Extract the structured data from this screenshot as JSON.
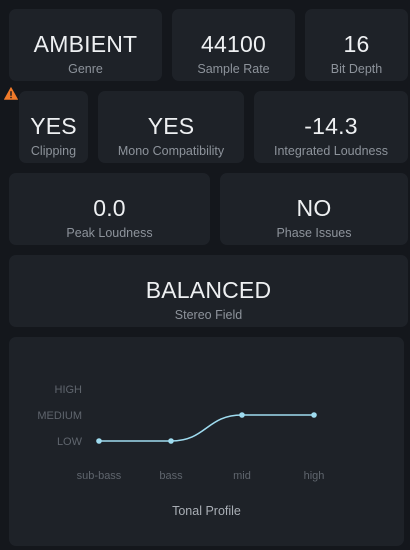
{
  "metrics": {
    "genre": {
      "value": "AMBIENT",
      "label": "Genre"
    },
    "sample_rate": {
      "value": "44100",
      "label": "Sample Rate"
    },
    "bit_depth": {
      "value": "16",
      "label": "Bit Depth"
    },
    "clipping": {
      "value": "YES",
      "label": "Clipping",
      "warning_icon": "warning-triangle-icon"
    },
    "mono_compatibility": {
      "value": "YES",
      "label": "Mono Compatibility"
    },
    "integrated_loudness": {
      "value": "-14.3",
      "label": "Integrated Loudness"
    },
    "peak_loudness": {
      "value": "0.0",
      "label": "Peak Loudness"
    },
    "phase_issues": {
      "value": "NO",
      "label": "Phase Issues"
    },
    "stereo_field": {
      "value": "BALANCED",
      "label": "Stereo Field"
    }
  },
  "colors": {
    "background": "#14171c",
    "card": "#1e2228",
    "warning": "#f07a2a",
    "curve": "#9fdcf0"
  },
  "chart_data": {
    "type": "line",
    "title": "Tonal Profile",
    "categories": [
      "sub-bass",
      "bass",
      "mid",
      "high"
    ],
    "y_levels": [
      "LOW",
      "MEDIUM",
      "HIGH"
    ],
    "series": [
      {
        "values": [
          1.0,
          1.0,
          2.0,
          2.0
        ]
      }
    ],
    "ylim": [
      1,
      3
    ],
    "smooth": true,
    "grid": false,
    "legend": "none"
  }
}
